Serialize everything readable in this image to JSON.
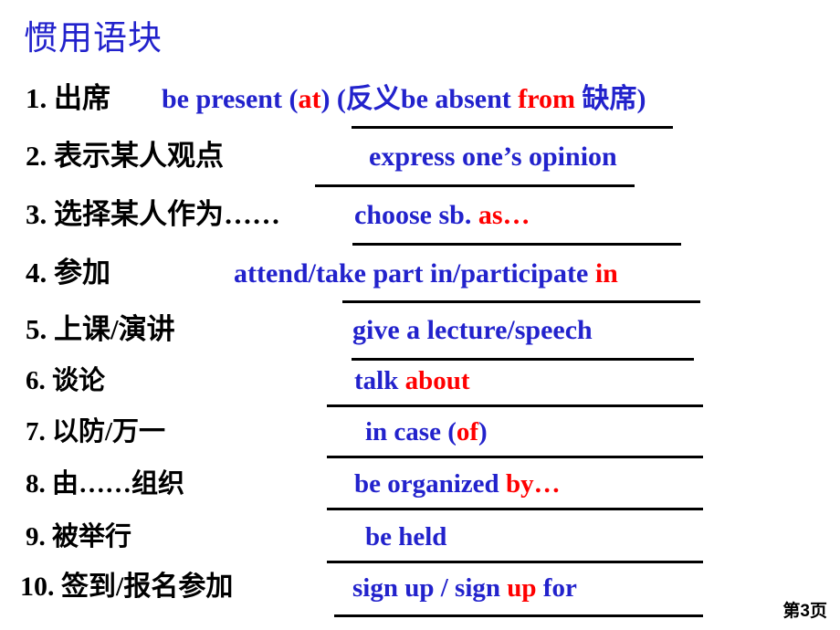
{
  "slide": {
    "title": "惯用语块",
    "title_color": "#2222cc",
    "background_color": "#ffffff",
    "page_badge": "第3页"
  },
  "colors": {
    "blue": "#2222cc",
    "red": "#ff0000",
    "black": "#000000"
  },
  "items": [
    {
      "number": "1.",
      "chinese": "1. 出席",
      "english_plain": "be present (at) (反义be absent from 缺席)",
      "segments": [
        {
          "text": "be present (",
          "color": "blue"
        },
        {
          "text": "at",
          "color": "red"
        },
        {
          "text": ") (反义be absent ",
          "color": "blue"
        },
        {
          "text": "from",
          "color": "red"
        },
        {
          "text": " 缺席)",
          "color": "blue"
        }
      ]
    },
    {
      "number": "2.",
      "chinese": "2. 表示某人观点",
      "english_plain": "express one’s opinion",
      "segments": [
        {
          "text": "express one’s opinion",
          "color": "blue"
        }
      ]
    },
    {
      "number": "3.",
      "chinese": "3. 选择某人作为……",
      "english_plain": "choose sb. as…",
      "segments": [
        {
          "text": "choose sb. ",
          "color": "blue"
        },
        {
          "text": "as…",
          "color": "red"
        }
      ]
    },
    {
      "number": "4.",
      "chinese": "4. 参加",
      "english_plain": "attend/take part in/participate in",
      "segments": [
        {
          "text": "attend/take part in/participate ",
          "color": "blue"
        },
        {
          "text": "in",
          "color": "red"
        }
      ]
    },
    {
      "number": "5.",
      "chinese": "5. 上课/演讲",
      "english_plain": "give a lecture/speech",
      "segments": [
        {
          "text": "give a lecture/speech",
          "color": "blue"
        }
      ]
    },
    {
      "number": "6.",
      "chinese": "6. 谈论",
      "english_plain": "talk about",
      "segments": [
        {
          "text": "talk ",
          "color": "blue"
        },
        {
          "text": "about",
          "color": "red"
        }
      ]
    },
    {
      "number": "7.",
      "chinese": "7. 以防/万一",
      "english_plain": "in case (of)",
      "segments": [
        {
          "text": "in case (",
          "color": "blue"
        },
        {
          "text": "of",
          "color": "red"
        },
        {
          "text": ")",
          "color": "blue"
        }
      ]
    },
    {
      "number": "8.",
      "chinese": "8. 由……组织",
      "english_plain": "be organized by…",
      "segments": [
        {
          "text": "be organized ",
          "color": "blue"
        },
        {
          "text": "by…",
          "color": "red"
        }
      ]
    },
    {
      "number": "9.",
      "chinese": "9. 被举行",
      "english_plain": "be held",
      "segments": [
        {
          "text": "be held",
          "color": "blue"
        }
      ]
    },
    {
      "number": "10.",
      "chinese": "10. 签到/报名参加",
      "english_plain": "sign up / sign up for",
      "segments": [
        {
          "text": "sign up / sign ",
          "color": "blue"
        },
        {
          "text": "up",
          "color": "red"
        },
        {
          "text": " for",
          "color": "blue"
        }
      ]
    }
  ]
}
